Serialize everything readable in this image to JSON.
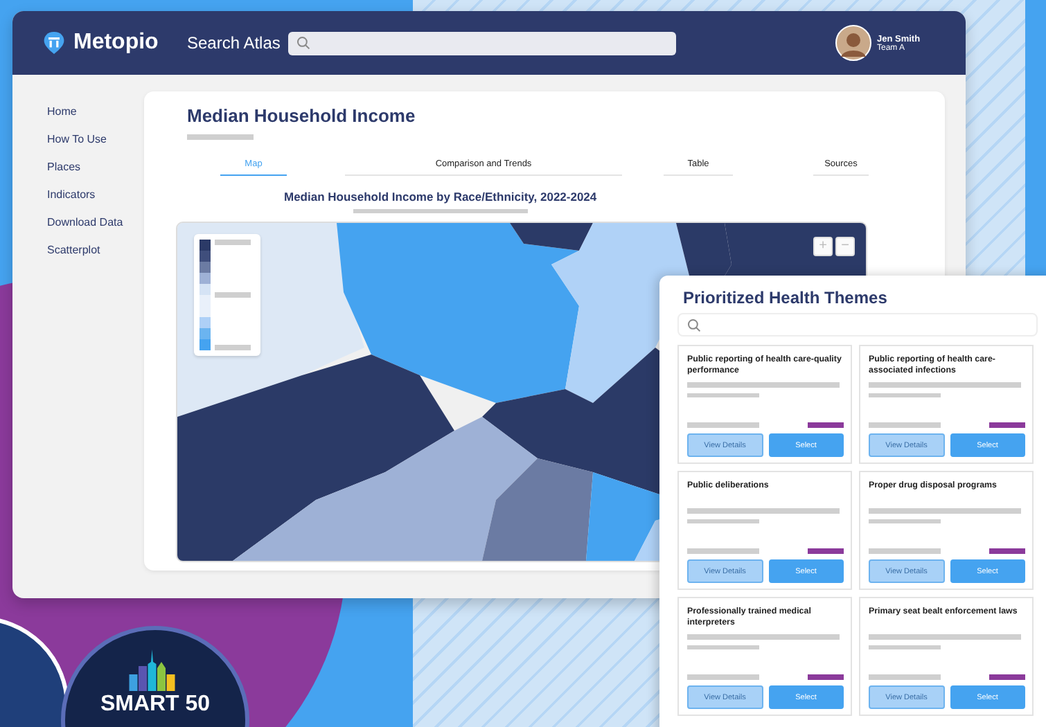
{
  "header": {
    "brand": "Metopio",
    "search_label": "Search Atlas",
    "user": {
      "name": "Jen Smith",
      "team": "Team A"
    }
  },
  "sidebar": {
    "items": [
      "Home",
      "How To Use",
      "Places",
      "Indicators",
      "Download Data",
      "Scatterplot"
    ]
  },
  "main": {
    "title": "Median Household Income",
    "tabs": [
      {
        "label": "Map",
        "selected": true
      },
      {
        "label": "Comparison and Trends",
        "selected": false
      },
      {
        "label": "Table",
        "selected": false
      },
      {
        "label": "Sources",
        "selected": false
      }
    ],
    "map_title": "Median Household Income by Race/Ethnicity, 2022-2024",
    "zoom_controls": [
      "+",
      "−"
    ]
  },
  "panel": {
    "title": "Prioritized Health Themes",
    "cards": [
      {
        "title": "Public reporting of health care-quality performance",
        "buttons": [
          "View Details",
          "Select"
        ]
      },
      {
        "title": "Public reporting of health care-associated infections",
        "buttons": [
          "View Details",
          "Select"
        ]
      },
      {
        "title": "Public deliberations",
        "buttons": [
          "View Details",
          "Select"
        ]
      },
      {
        "title": "Proper drug disposal programs",
        "buttons": [
          "View Details",
          "Select"
        ]
      },
      {
        "title": "Professionally trained medical interpreters",
        "buttons": [
          "View Details",
          "Select"
        ]
      },
      {
        "title": "Primary seat bealt enforcement laws",
        "buttons": [
          "View Details",
          "Select"
        ]
      }
    ]
  },
  "badge": {
    "text": "SMART 50"
  }
}
